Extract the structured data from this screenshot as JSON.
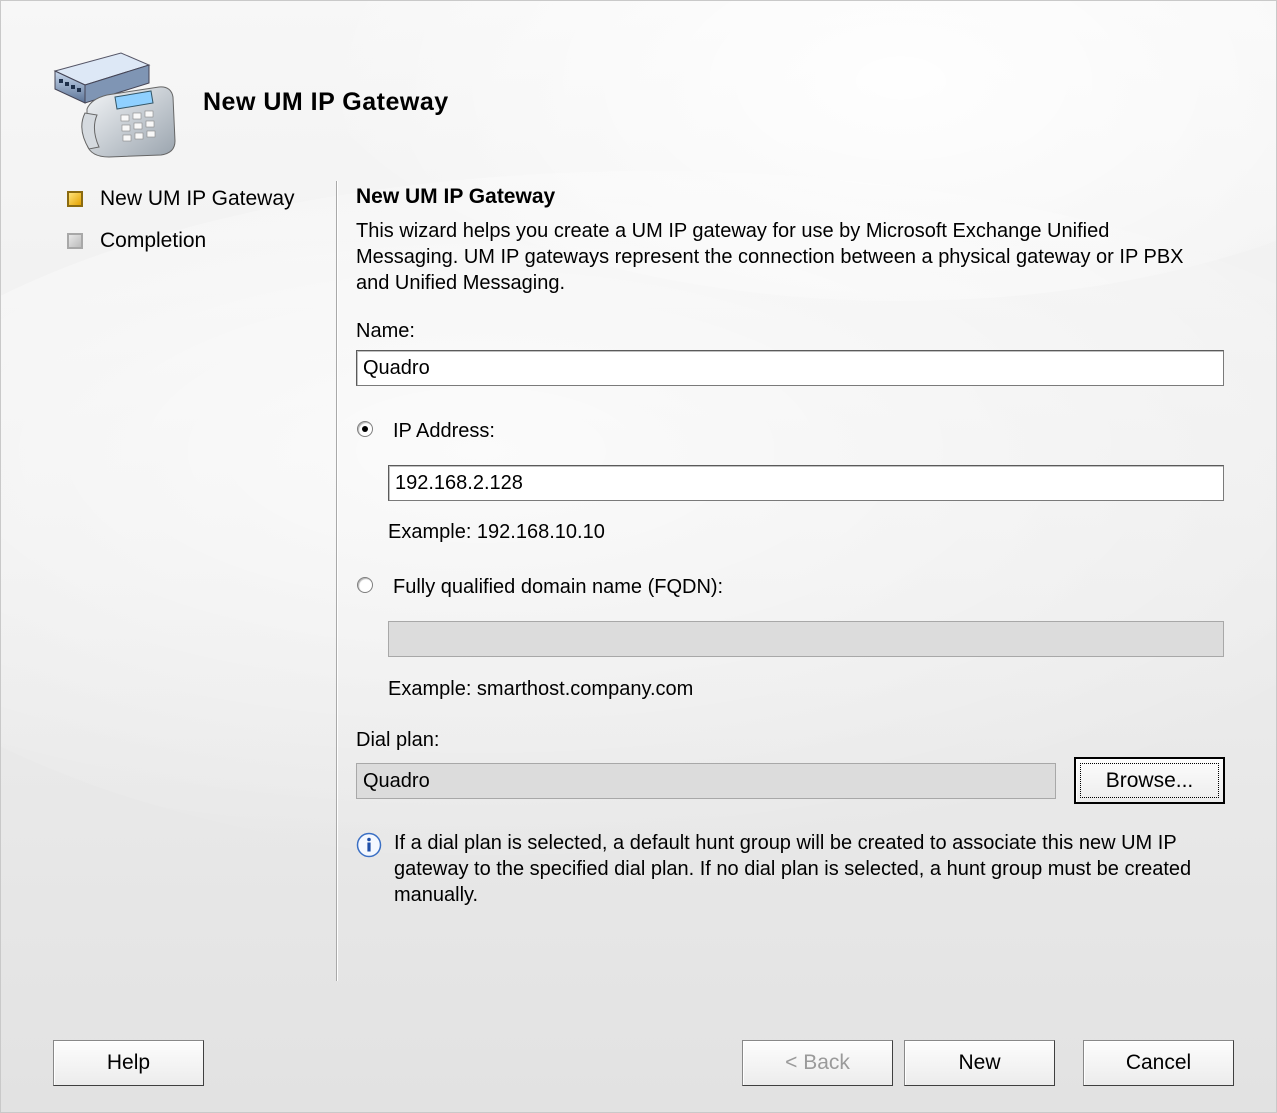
{
  "window": {
    "title": "New UM IP Gateway"
  },
  "nav": {
    "items": [
      {
        "label": "New UM IP Gateway",
        "state": "active"
      },
      {
        "label": "Completion",
        "state": "inactive"
      }
    ]
  },
  "page": {
    "section_title": "New UM IP Gateway",
    "description": "This wizard helps you create a UM IP gateway for use by Microsoft Exchange Unified Messaging. UM IP gateways represent the connection between a physical gateway or IP PBX and Unified Messaging.",
    "name_label": "Name:",
    "name_value": "Quadro",
    "ip_radio_label": "IP Address:",
    "ip_selected": true,
    "ip_value": "192.168.2.128",
    "ip_example": "Example: 192.168.10.10",
    "fqdn_radio_label": "Fully qualified domain name (FQDN):",
    "fqdn_value": "",
    "fqdn_example": "Example: smarthost.company.com",
    "dialplan_label": "Dial plan:",
    "dialplan_value": "Quadro",
    "browse_label": "Browse...",
    "info_text": "If a dial plan is selected, a default hunt group will be created to associate this new UM IP gateway to the specified dial plan. If no dial plan is selected, a hunt group must be created manually."
  },
  "buttons": {
    "help": "Help",
    "back": "< Back",
    "new": "New",
    "cancel": "Cancel"
  },
  "icons": {
    "header": "gateway-phone-icon",
    "info": "info-icon"
  }
}
